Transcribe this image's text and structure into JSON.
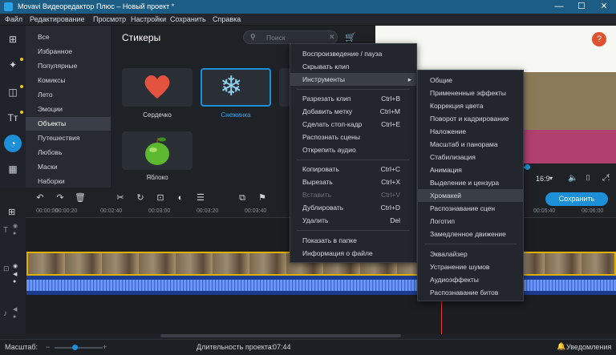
{
  "window": {
    "title": "Movavi Видеоредактор Плюс – Новый проект *",
    "min": "—",
    "max": "☐",
    "close": "✕"
  },
  "menu": [
    "Файл",
    "Редактирование",
    "Просмотр",
    "Настройки",
    "Сохранить",
    "Справка"
  ],
  "categories": [
    "Все",
    "Избранное",
    "Популярные",
    "Комиксы",
    "Лето",
    "Эмоции",
    "Объекты",
    "Путешествия",
    "Любовь",
    "Маски",
    "Наборки"
  ],
  "stickers": {
    "title": "Стикеры",
    "search_placeholder": "Поиск",
    "items": [
      {
        "label": "Сердечко"
      },
      {
        "label": "Снежинка"
      },
      {
        "label": "Яблоко"
      }
    ]
  },
  "preview": {
    "aspect": "16:9",
    "help": "?"
  },
  "save_label": "Сохранить",
  "ruler": [
    "00:00:00",
    "00:00:20",
    "00:02:40",
    "00:03:00",
    "00:03:20",
    "00:03:40",
    "00:05:40",
    "00:06:00"
  ],
  "context_menu": [
    {
      "label": "Воспроизведение / пауза",
      "shortcut": ""
    },
    {
      "label": "Скрывать клип",
      "shortcut": ""
    },
    {
      "label": "Инструменты",
      "shortcut": "",
      "arrow": "▸"
    },
    {
      "label": "Разрезать клип",
      "shortcut": "Ctrl+B"
    },
    {
      "label": "Добавить метку",
      "shortcut": "Ctrl+M"
    },
    {
      "label": "Сделать стоп-кадр",
      "shortcut": "Ctrl+E"
    },
    {
      "label": "Распознать сцены",
      "shortcut": ""
    },
    {
      "label": "Открепить аудио",
      "shortcut": ""
    },
    {
      "label": "Копировать",
      "shortcut": "Ctrl+C"
    },
    {
      "label": "Вырезать",
      "shortcut": "Ctrl+X"
    },
    {
      "label": "Вставить",
      "shortcut": "Ctrl+V"
    },
    {
      "label": "Дублировать",
      "shortcut": "Ctrl+D"
    },
    {
      "label": "Удалить",
      "shortcut": "Del"
    },
    {
      "label": "Показать в папке",
      "shortcut": ""
    },
    {
      "label": "Информация о файле",
      "shortcut": ""
    }
  ],
  "submenu": [
    "Общие",
    "Примененные эффекты",
    "Коррекция цвета",
    "Поворот и кадрирование",
    "Наложение",
    "Масштаб и панорама",
    "Стабилизация",
    "Анимация",
    "Выделение и цензура",
    "Хромакей",
    "Распознавание сцен",
    "Логотип",
    "Замедленное движение",
    "Эквалайзер",
    "Устранение шумов",
    "Аудиоэффекты",
    "Распознавание битов"
  ],
  "status": {
    "scale_label": "Масштаб:",
    "duration_label": "Длительность проекта:",
    "duration": "07:44",
    "notifications": "Уведомления"
  },
  "colors": {
    "accent": "#1d8fd6",
    "highlight": "#e0b000"
  }
}
